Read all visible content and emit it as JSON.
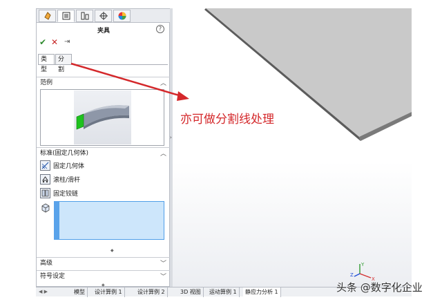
{
  "property_manager": {
    "tabs": [
      {
        "icon": "feature-manager-icon"
      },
      {
        "icon": "property-manager-icon",
        "active": true
      },
      {
        "icon": "configuration-manager-icon"
      },
      {
        "icon": "dimxpert-icon"
      },
      {
        "icon": "display-manager-icon"
      }
    ],
    "title": "夹具",
    "help": "?",
    "ok": "✔",
    "cancel": "✕",
    "pin": "⇥",
    "type_tabs": [
      "类型",
      "分割"
    ],
    "example_section": "范例",
    "standard_section": "标准(固定几何体)",
    "fixtures": [
      "固定几何体",
      "滚柱/滑杆",
      "固定铰链"
    ],
    "advanced_section": "高级",
    "symbol_section": "符号设定"
  },
  "viewport": {
    "annotation": "亦可做分割线处理",
    "annotation_color": "#d4282b"
  },
  "bottom_tabs": [
    "模型",
    "设计算例 1",
    "设计算例 2",
    "3D 视图",
    "运动算例 1",
    "静应力分析 1"
  ],
  "watermark": "头条 @数字化企业",
  "colors": {
    "selection_fill": "#cde6fb",
    "selection_border": "#4f9ee8",
    "face_green": "#1ec21e"
  }
}
